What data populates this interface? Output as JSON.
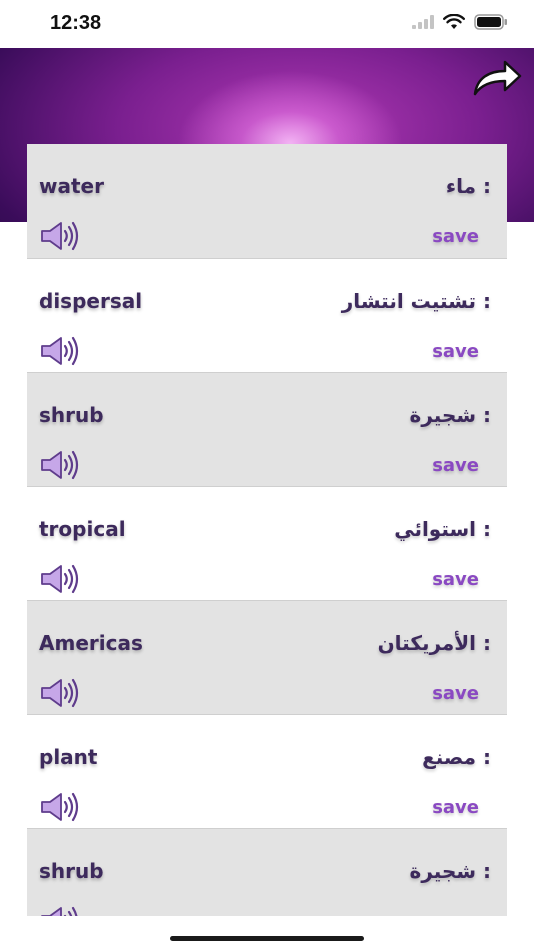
{
  "status_bar": {
    "time": "12:38"
  },
  "colors": {
    "word_text": "#3d2a5c",
    "save_text": "#8a49c2",
    "row_shaded": "#e3e3e3",
    "banner_accent": "#b23ab6"
  },
  "icons": {
    "share": "curved-arrow-icon",
    "speaker": "speaker-icon"
  },
  "words": [
    {
      "en": "water",
      "ar": ": ماء",
      "save": "save",
      "shaded": true
    },
    {
      "en": "dispersal",
      "ar": ": تشتيت انتشار",
      "save": "save",
      "shaded": false
    },
    {
      "en": "shrub",
      "ar": ": شجيرة",
      "save": "save",
      "shaded": true
    },
    {
      "en": "tropical",
      "ar": ": استوائي",
      "save": "save",
      "shaded": false
    },
    {
      "en": "Americas",
      "ar": ": الأمريكتان",
      "save": "save",
      "shaded": true
    },
    {
      "en": "plant",
      "ar": ": مصنع",
      "save": "save",
      "shaded": false
    },
    {
      "en": "shrub",
      "ar": ": شجيرة",
      "save": "save",
      "shaded": true
    }
  ]
}
